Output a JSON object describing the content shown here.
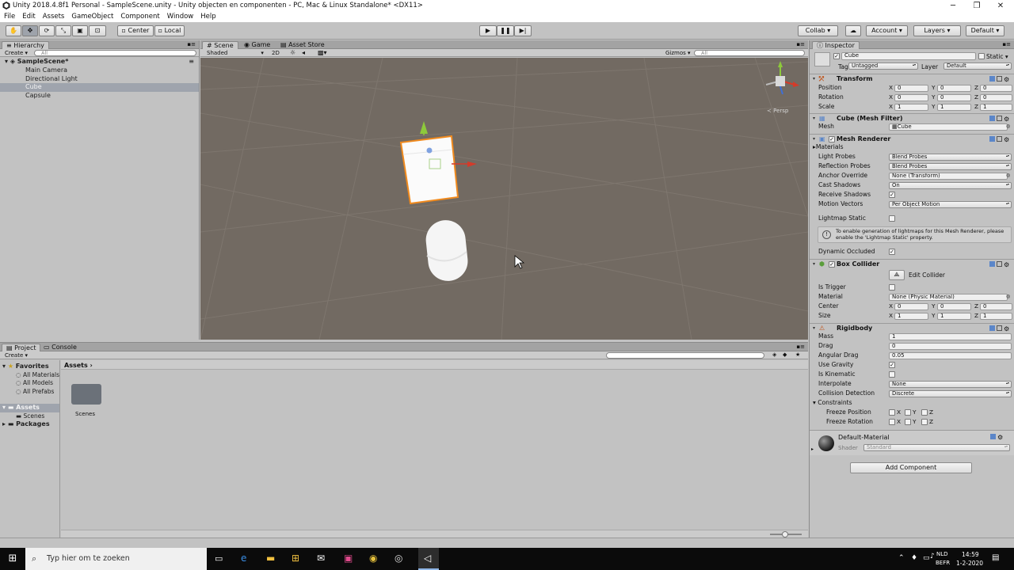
{
  "window": {
    "title": "Unity 2018.4.8f1 Personal - SampleScene.unity - Unity objecten en componenten - PC, Mac & Linux Standalone* <DX11>",
    "minimize": "─",
    "maximize": "❐",
    "close": "✕"
  },
  "menu": [
    "File",
    "Edit",
    "Assets",
    "GameObject",
    "Component",
    "Window",
    "Help"
  ],
  "toolbar": {
    "pivot": "Center",
    "space": "Local",
    "collab": "Collab ▾",
    "account": "Account",
    "layers": "Layers",
    "layout": "Default"
  },
  "hierarchy": {
    "tab": "Hierarchy",
    "create": "Create ▾",
    "search_placeholder": "All",
    "scene": "SampleScene*",
    "items": [
      {
        "label": "Main Camera",
        "selected": false
      },
      {
        "label": "Directional Light",
        "selected": false
      },
      {
        "label": "Cube",
        "selected": true
      },
      {
        "label": "Capsule",
        "selected": false
      }
    ]
  },
  "scene_view": {
    "tabs": [
      "Scene",
      "Game",
      "Asset Store"
    ],
    "shading": "Shaded",
    "mode_2d": "2D",
    "gizmos": "Gizmos",
    "search_placeholder": "All",
    "persp": "Persp"
  },
  "inspector": {
    "tab": "Inspector",
    "object_name": "Cube",
    "static_label": "Static",
    "tag_label": "Tag",
    "tag_value": "Untagged",
    "layer_label": "Layer",
    "layer_value": "Default",
    "transform": {
      "title": "Transform",
      "position_label": "Position",
      "rotation_label": "Rotation",
      "scale_label": "Scale",
      "position": [
        "0",
        "0",
        "0"
      ],
      "rotation": [
        "0",
        "0",
        "0"
      ],
      "scale": [
        "1",
        "1",
        "1"
      ]
    },
    "mesh_filter": {
      "title": "Cube (Mesh Filter)",
      "mesh_label": "Mesh",
      "mesh_value": "Cube"
    },
    "mesh_renderer": {
      "title": "Mesh Renderer",
      "materials_label": "Materials",
      "light_probes_label": "Light Probes",
      "light_probes": "Blend Probes",
      "reflection_probes_label": "Reflection Probes",
      "reflection_probes": "Blend Probes",
      "anchor_override_label": "Anchor Override",
      "anchor_override": "None (Transform)",
      "cast_shadows_label": "Cast Shadows",
      "cast_shadows": "On",
      "receive_shadows_label": "Receive Shadows",
      "motion_vectors_label": "Motion Vectors",
      "motion_vectors": "Per Object Motion",
      "lightmap_static_label": "Lightmap Static",
      "info": "To enable generation of lightmaps for this Mesh Renderer, please enable the 'Lightmap Static' property.",
      "dynamic_occluded_label": "Dynamic Occluded"
    },
    "box_collider": {
      "title": "Box Collider",
      "edit_collider": "Edit Collider",
      "is_trigger_label": "Is Trigger",
      "material_label": "Material",
      "material": "None (Physic Material)",
      "center_label": "Center",
      "size_label": "Size",
      "center": [
        "0",
        "0",
        "0"
      ],
      "size": [
        "1",
        "1",
        "1"
      ]
    },
    "rigidbody": {
      "title": "Rigidbody",
      "mass_label": "Mass",
      "mass": "1",
      "drag_label": "Drag",
      "drag": "0",
      "angular_drag_label": "Angular Drag",
      "angular_drag": "0.05",
      "use_gravity_label": "Use Gravity",
      "is_kinematic_label": "Is Kinematic",
      "interpolate_label": "Interpolate",
      "interpolate": "None",
      "collision_detection_label": "Collision Detection",
      "collision_detection": "Discrete",
      "constraints_label": "Constraints",
      "freeze_position_label": "Freeze Position",
      "freeze_rotation_label": "Freeze Rotation"
    },
    "material": {
      "name": "Default-Material",
      "shader_label": "Shader",
      "shader": "Standard"
    },
    "add_component": "Add Component"
  },
  "project": {
    "tabs": [
      "Project",
      "Console"
    ],
    "create": "Create ▾",
    "favorites": "Favorites",
    "favorite_items": [
      "All Materials",
      "All Models",
      "All Prefabs"
    ],
    "assets": "Assets",
    "scenes": "Scenes",
    "packages": "Packages",
    "breadcrumb": "Assets",
    "folder_label": "Scenes"
  },
  "taskbar": {
    "search_placeholder": "Typ hier om te zoeken",
    "lang1": "NLD",
    "lang2": "BEFR",
    "time": "14:59",
    "date": "1-2-2020"
  },
  "colors": {
    "scene_bg": "#726a62",
    "selection": "#9fa4ad",
    "panel": "#c2c2c2",
    "gizmo_x": "#d33b2a",
    "gizmo_y": "#8dc93b",
    "gizmo_z": "#3f6fd8",
    "outline": "#f08a1e"
  }
}
